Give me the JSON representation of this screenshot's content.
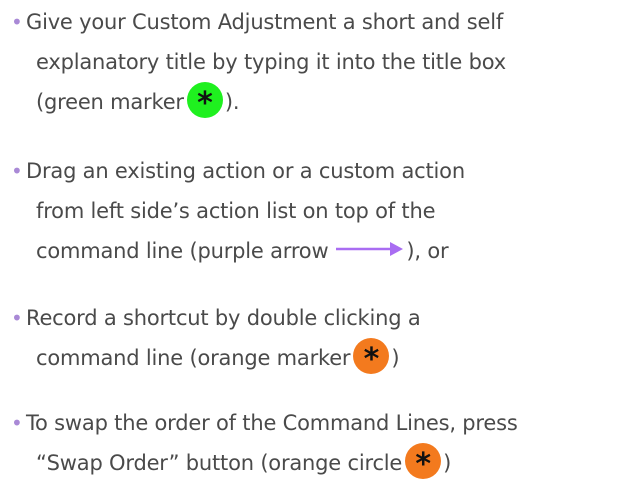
{
  "instructions": [
    {
      "parts": [
        {
          "kind": "text",
          "line": 1,
          "text": "Give your Custom Adjustment a short and self"
        },
        {
          "kind": "text",
          "line": 2,
          "text": "explanatory title by typing it into the title box"
        },
        {
          "kind": "text",
          "line": 3,
          "text": "(green marker"
        },
        {
          "kind": "marker",
          "line": 3,
          "color": "#1ff01f",
          "icon": "asterisk-icon"
        },
        {
          "kind": "text",
          "line": 3,
          "text": ")."
        }
      ]
    },
    {
      "parts": [
        {
          "kind": "text",
          "line": 1,
          "text": "Drag an existing action or a custom action"
        },
        {
          "kind": "text",
          "line": 2,
          "text": "from left side’s action list on top of the"
        },
        {
          "kind": "text",
          "line": 3,
          "text": "command line (purple arrow"
        },
        {
          "kind": "arrow",
          "line": 3,
          "color": "#a96df2",
          "icon": "arrow-right-icon"
        },
        {
          "kind": "text",
          "line": 3,
          "text": "), or"
        }
      ]
    },
    {
      "parts": [
        {
          "kind": "text",
          "line": 1,
          "text": "Record a shortcut by double clicking a"
        },
        {
          "kind": "text",
          "line": 2,
          "text": "command line (orange marker"
        },
        {
          "kind": "marker",
          "line": 2,
          "color": "#f37a1e",
          "icon": "asterisk-icon"
        },
        {
          "kind": "text",
          "line": 2,
          "text": ")"
        }
      ]
    },
    {
      "parts": [
        {
          "kind": "text",
          "line": 1,
          "text": "To swap the order of the Command Lines, press"
        },
        {
          "kind": "text",
          "line": 2,
          "text": "“Swap Order” button (orange circle"
        },
        {
          "kind": "marker",
          "line": 2,
          "color": "#f37a1e",
          "icon": "asterisk-icon"
        },
        {
          "kind": "text",
          "line": 2,
          "text": ")"
        }
      ]
    }
  ],
  "colors": {
    "text": "#4a4a4a",
    "bullet": "#a989d6",
    "green_marker": "#1ff01f",
    "orange_marker": "#f37a1e",
    "purple_arrow": "#a96df2"
  }
}
